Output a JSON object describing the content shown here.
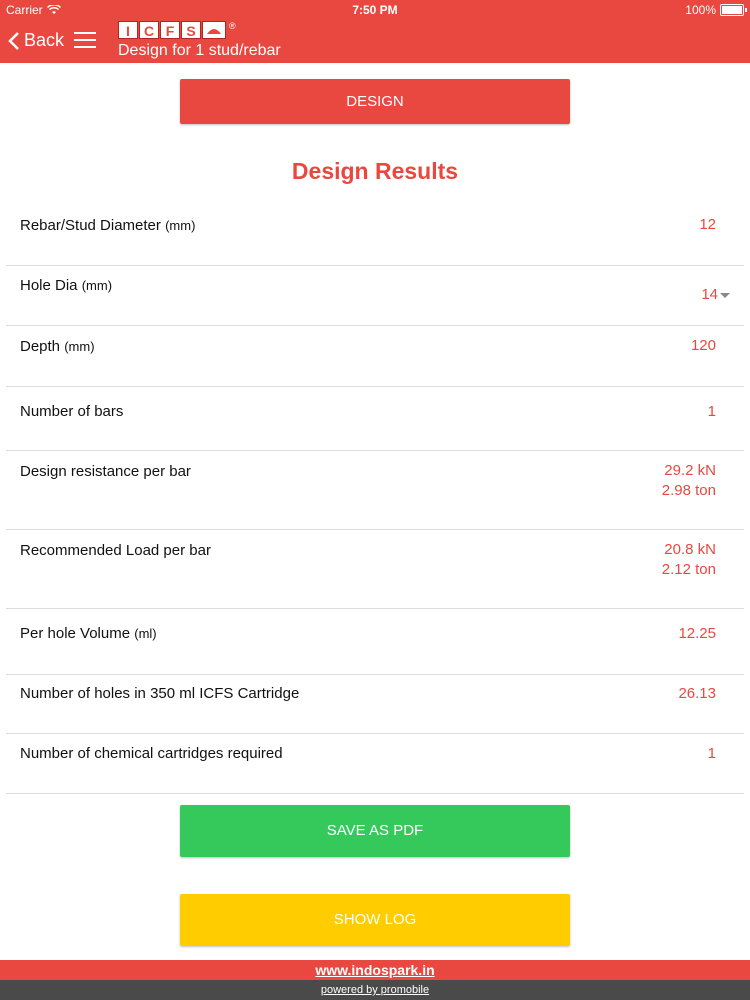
{
  "status_bar": {
    "carrier": "Carrier",
    "time": "7:50 PM",
    "battery": "100%"
  },
  "nav": {
    "back_label": "Back",
    "logo_letters": [
      "I",
      "C",
      "F",
      "S"
    ],
    "logo_reg": "®",
    "subtitle": "Design for 1 stud/rebar"
  },
  "buttons": {
    "design": "DESIGN",
    "save_pdf": "SAVE AS PDF",
    "show_log": "SHOW LOG"
  },
  "section_title": "Design Results",
  "results": [
    {
      "label": "Rebar/Stud Diameter",
      "unit": "(mm)",
      "value": "12"
    },
    {
      "label": "Hole Dia",
      "unit": "(mm)",
      "value": "14"
    },
    {
      "label": "Depth",
      "unit": "(mm)",
      "value": "120"
    },
    {
      "label": "Number of bars",
      "unit": "",
      "value": "1"
    },
    {
      "label": "Design resistance per bar",
      "unit": "",
      "value": "29.2 kN",
      "value2": "2.98 ton"
    },
    {
      "label": "Recommended Load per bar",
      "unit": "",
      "value": "20.8 kN",
      "value2": "2.12 ton"
    },
    {
      "label": "Per hole Volume",
      "unit": "(ml)",
      "value": "12.25"
    },
    {
      "label": "Number of holes in 350 ml ICFS Cartridge",
      "unit": "",
      "value": "26.13"
    },
    {
      "label": "Number of chemical cartridges required",
      "unit": "",
      "value": "1"
    }
  ],
  "footer": {
    "site": "www.indospark.in",
    "powered": "powered by promobile"
  },
  "colors": {
    "brand_red": "#e8483f",
    "green": "#35c95b",
    "yellow": "#ffcc00"
  }
}
